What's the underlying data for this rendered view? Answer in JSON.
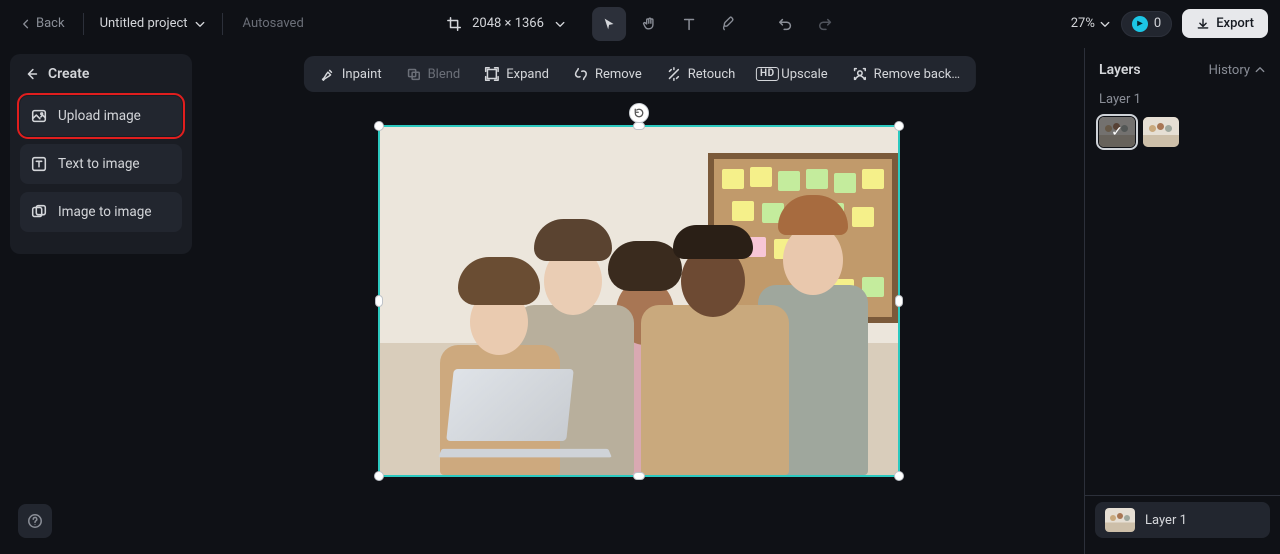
{
  "topbar": {
    "back_label": "Back",
    "project_name": "Untitled project",
    "autosaved_label": "Autosaved",
    "dimensions": "2048 × 1366",
    "zoom_label": "27%",
    "credits_count": "0",
    "export_label": "Export"
  },
  "sidebar": {
    "title": "Create",
    "items": [
      {
        "label": "Upload image"
      },
      {
        "label": "Text to image"
      },
      {
        "label": "Image to image"
      }
    ]
  },
  "action_bar": {
    "inpaint": "Inpaint",
    "blend": "Blend",
    "expand": "Expand",
    "remove": "Remove",
    "retouch": "Retouch",
    "upscale": "Upscale",
    "remove_bg": "Remove back…"
  },
  "right_panel": {
    "title": "Layers",
    "history_label": "History",
    "current_layer_label": "Layer 1",
    "layer_row_label": "Layer 1"
  }
}
